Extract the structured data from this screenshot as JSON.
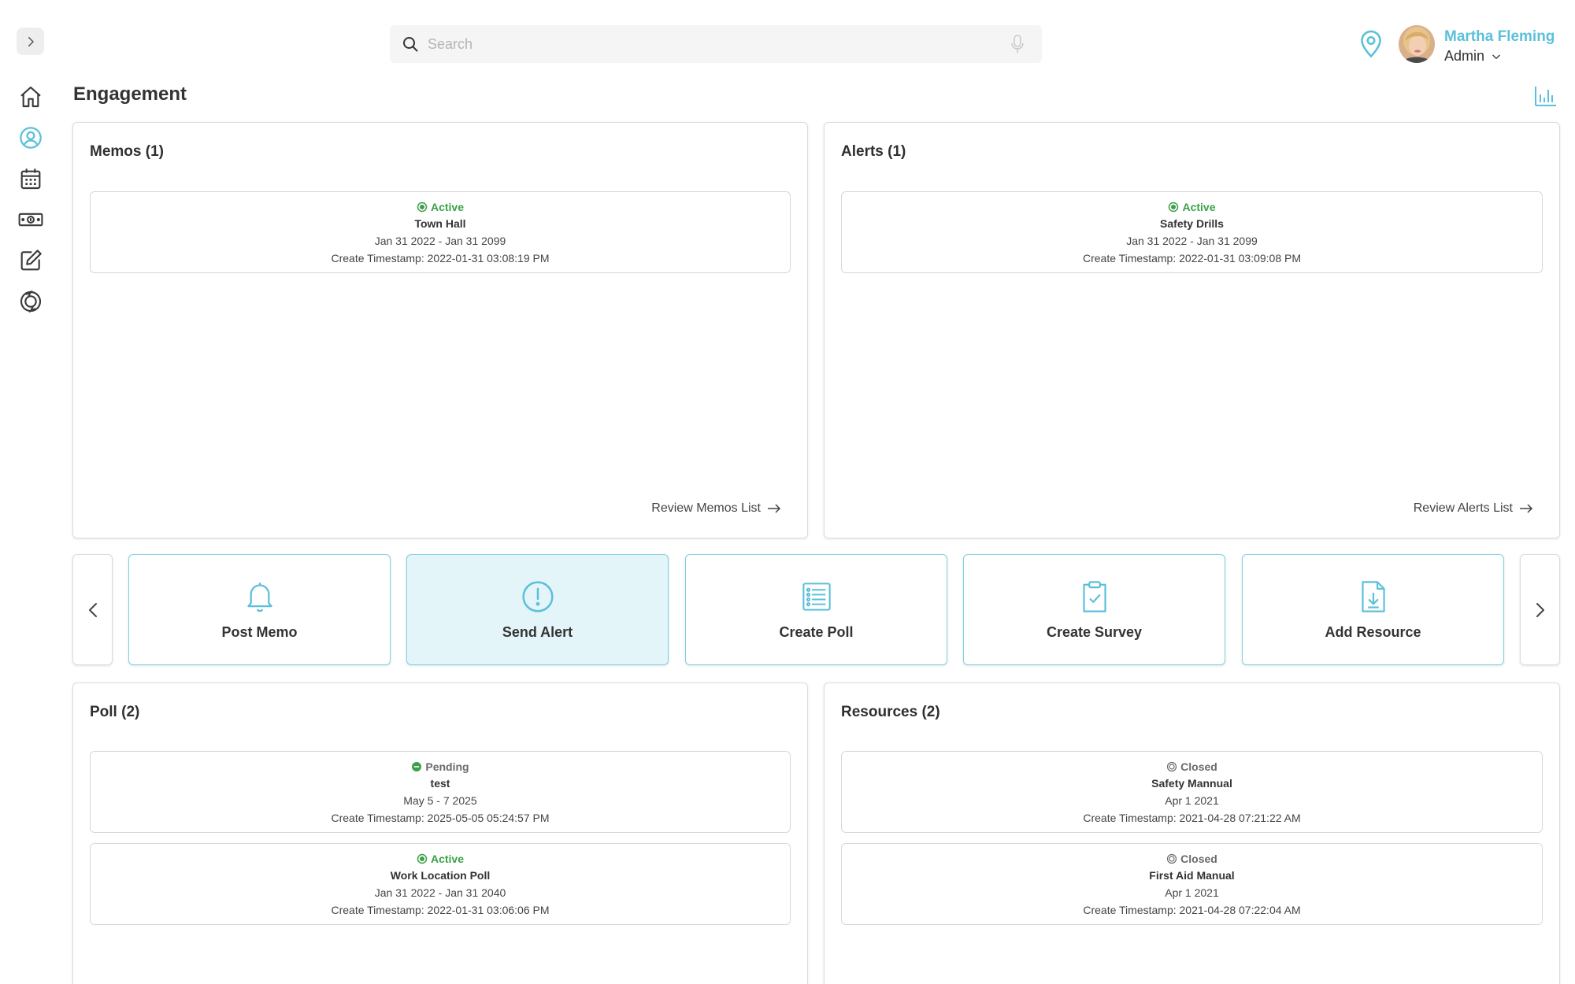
{
  "header": {
    "search_placeholder": "Search",
    "user_name": "Martha Fleming",
    "user_role": "Admin"
  },
  "page": {
    "title": "Engagement"
  },
  "colors": {
    "accent": "#5cc0da",
    "active_green": "#3aa047",
    "closed_grey": "#6a6a6a"
  },
  "sidebar": {
    "items": [
      {
        "name": "home-icon"
      },
      {
        "name": "user-circle-icon",
        "active": true
      },
      {
        "name": "calendar-icon"
      },
      {
        "name": "money-icon"
      },
      {
        "name": "edit-icon"
      },
      {
        "name": "sync-icon"
      }
    ]
  },
  "memos": {
    "title": "Memos (1)",
    "review_label": "Review Memos List",
    "items": [
      {
        "status": "Active",
        "name": "Town Hall",
        "dates": "Jan 31 2022 - Jan 31 2099",
        "timestamp": "Create Timestamp: 2022-01-31 03:08:19 PM"
      }
    ]
  },
  "alerts": {
    "title": "Alerts (1)",
    "review_label": "Review Alerts List",
    "items": [
      {
        "status": "Active",
        "name": "Safety Drills",
        "dates": "Jan 31 2022 - Jan 31 2099",
        "timestamp": "Create Timestamp: 2022-01-31 03:09:08 PM"
      }
    ]
  },
  "actions": [
    {
      "label": "Post Memo",
      "icon": "bell-icon"
    },
    {
      "label": "Send Alert",
      "icon": "alert-circle-icon",
      "selected": true
    },
    {
      "label": "Create Poll",
      "icon": "list-icon"
    },
    {
      "label": "Create Survey",
      "icon": "clipboard-check-icon"
    },
    {
      "label": "Add Resource",
      "icon": "file-download-icon"
    }
  ],
  "poll": {
    "title": "Poll (2)",
    "items": [
      {
        "status": "Pending",
        "name": "test",
        "dates": "May 5 - 7 2025",
        "timestamp": "Create Timestamp: 2025-05-05 05:24:57 PM"
      },
      {
        "status": "Active",
        "name": "Work Location Poll",
        "dates": "Jan 31 2022 - Jan 31 2040",
        "timestamp": "Create Timestamp: 2022-01-31 03:06:06 PM"
      }
    ]
  },
  "resources": {
    "title": "Resources (2)",
    "items": [
      {
        "status": "Closed",
        "name": "Safety Mannual",
        "dates": "Apr 1 2021",
        "timestamp": "Create Timestamp: 2021-04-28 07:21:22 AM"
      },
      {
        "status": "Closed",
        "name": "First Aid Manual",
        "dates": "Apr 1 2021",
        "timestamp": "Create Timestamp: 2021-04-28 07:22:04 AM"
      }
    ]
  }
}
